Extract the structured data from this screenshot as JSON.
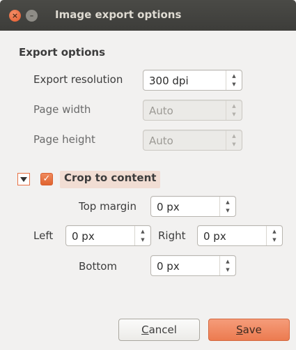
{
  "window": {
    "title": "Image export options",
    "close_glyph": "×",
    "minimize_glyph": "–"
  },
  "export_options": {
    "section_title": "Export options",
    "resolution": {
      "label": "Export resolution",
      "value": "300 dpi",
      "enabled": true
    },
    "page_width": {
      "label": "Page width",
      "value": "Auto",
      "enabled": false
    },
    "page_height": {
      "label": "Page height",
      "value": "Auto",
      "enabled": false
    }
  },
  "crop": {
    "label": "Crop to content",
    "checked": true,
    "expanded": true,
    "top_margin": {
      "label": "Top margin",
      "value": "0 px"
    },
    "left": {
      "label": "Left",
      "value": "0 px"
    },
    "right": {
      "label": "Right",
      "value": "0 px"
    },
    "bottom": {
      "label": "Bottom",
      "value": "0 px"
    }
  },
  "buttons": {
    "cancel_mnemonic": "C",
    "cancel_rest": "ancel",
    "save_mnemonic": "S",
    "save_rest": "ave"
  },
  "colors": {
    "accent": "#ec7b50",
    "titlebar": "#3d3d3a",
    "dialog_bg": "#f2f1f0"
  },
  "icons": {
    "close": "close-icon",
    "minimize": "minimize-icon",
    "expander": "triangle-down-icon",
    "checkbox": "checkmark-icon",
    "spin_up": "chevron-up-icon",
    "spin_down": "chevron-down-icon"
  }
}
